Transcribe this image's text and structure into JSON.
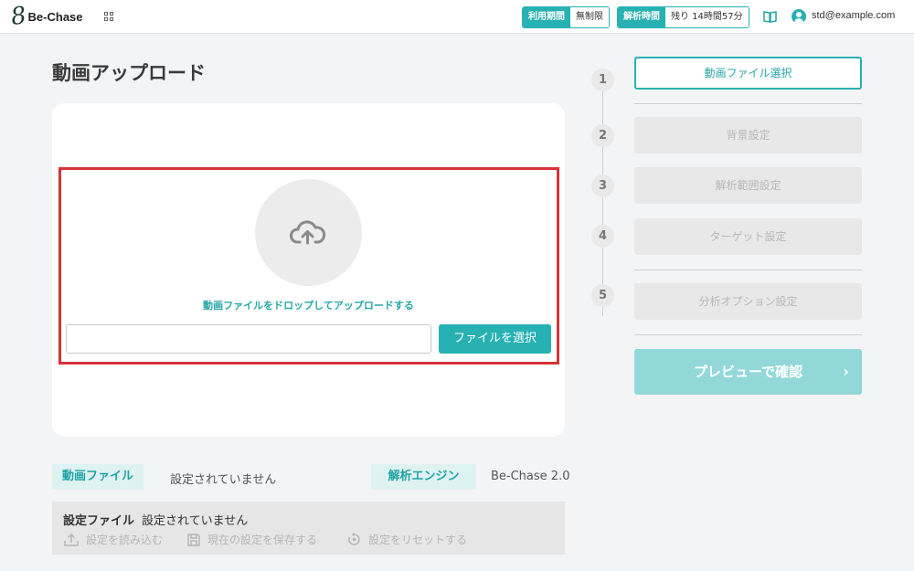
{
  "header": {
    "logo_mark": "8",
    "logo_text": "Be-Chase",
    "usage_label": "利用期間",
    "usage_value": "無制限",
    "time_label": "解析時間",
    "time_value": "残り 14時間57分",
    "user_email": "std@example.com"
  },
  "main": {
    "page_title": "動画アップロード",
    "drop_text": "動画ファイルをドロップしてアップロードする",
    "file_input_value": "",
    "select_file_label": "ファイルを選択"
  },
  "info": {
    "video_tag": "動画ファイル",
    "video_value": "設定されていません",
    "engine_tag": "解析エンジン",
    "engine_value": "Be-Chase 2.0"
  },
  "settings": {
    "label": "設定ファイル",
    "value": "設定されていません",
    "load": "設定を読み込む",
    "save": "現在の設定を保存する",
    "reset": "設定をリセットする"
  },
  "steps": [
    {
      "num": "1",
      "label": "動画ファイル選択"
    },
    {
      "num": "2",
      "label": "背景設定"
    },
    {
      "num": "3",
      "label": "解析範囲設定"
    },
    {
      "num": "4",
      "label": "ターゲット設定"
    },
    {
      "num": "5",
      "label": "分析オプション設定"
    }
  ],
  "preview_label": "プレビューで確認",
  "colors": {
    "accent": "#27b1b2",
    "highlight_frame": "#d7333a",
    "preview_disabled": "#93d8d9"
  }
}
